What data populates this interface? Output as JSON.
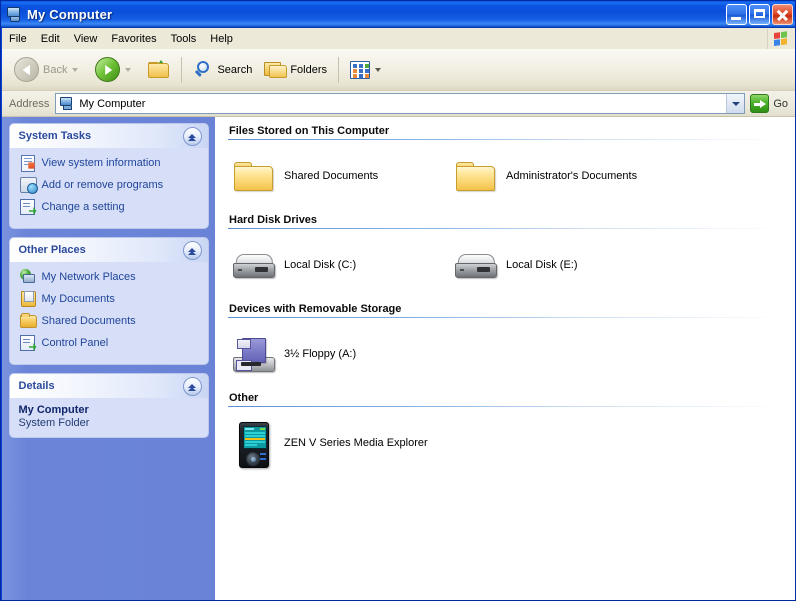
{
  "window": {
    "title": "My Computer",
    "title_icon": "my-computer-icon",
    "controls": {
      "minimize": "minimize-button",
      "maximize": "maximize-button",
      "close": "close-button"
    }
  },
  "menubar": {
    "items": [
      {
        "label": "File"
      },
      {
        "label": "Edit"
      },
      {
        "label": "View"
      },
      {
        "label": "Favorites"
      },
      {
        "label": "Tools"
      },
      {
        "label": "Help"
      }
    ],
    "brand_icon": "windows-flag-icon"
  },
  "toolbar": {
    "back_label": "Back",
    "back_icon": "back-arrow-icon",
    "forward_icon": "forward-arrow-icon",
    "up_icon": "up-folder-icon",
    "search_label": "Search",
    "search_icon": "search-magnifier-icon",
    "folders_label": "Folders",
    "folders_icon": "folders-icon",
    "views_icon": "views-grid-icon"
  },
  "address": {
    "label": "Address",
    "value": "My Computer",
    "icon": "my-computer-icon",
    "dropdown_icon": "chevron-down-icon",
    "go_label": "Go",
    "go_icon": "go-arrow-icon"
  },
  "sidebar": {
    "panels": [
      {
        "title": "System Tasks",
        "collapse_icon": "chevron-up-icon",
        "items": [
          {
            "label": "View system information",
            "icon": "system-info-icon"
          },
          {
            "label": "Add or remove programs",
            "icon": "add-remove-programs-icon"
          },
          {
            "label": "Change a setting",
            "icon": "change-setting-icon"
          }
        ]
      },
      {
        "title": "Other Places",
        "collapse_icon": "chevron-up-icon",
        "items": [
          {
            "label": "My Network Places",
            "icon": "network-places-icon"
          },
          {
            "label": "My Documents",
            "icon": "my-documents-icon"
          },
          {
            "label": "Shared Documents",
            "icon": "shared-documents-icon"
          },
          {
            "label": "Control Panel",
            "icon": "control-panel-icon"
          }
        ]
      },
      {
        "title": "Details",
        "collapse_icon": "chevron-up-icon",
        "name": "My Computer",
        "type": "System Folder"
      }
    ]
  },
  "content": {
    "groups": [
      {
        "title": "Files Stored on This Computer",
        "items": [
          {
            "label": "Shared Documents",
            "icon": "folder-icon"
          },
          {
            "label": "Administrator's Documents",
            "icon": "folder-icon"
          }
        ]
      },
      {
        "title": "Hard Disk Drives",
        "items": [
          {
            "label": "Local Disk (C:)",
            "icon": "hard-disk-icon"
          },
          {
            "label": "Local Disk (E:)",
            "icon": "hard-disk-icon"
          }
        ]
      },
      {
        "title": "Devices with Removable Storage",
        "items": [
          {
            "label": "3½ Floppy (A:)",
            "icon": "floppy-drive-icon"
          }
        ]
      },
      {
        "title": "Other",
        "items": [
          {
            "label": "ZEN V Series Media Explorer",
            "icon": "media-player-icon"
          }
        ]
      }
    ]
  },
  "colors": {
    "titlebar_blue": "#0a4ed9",
    "sidebar_blue": "#6a83d6",
    "panel_body": "#d6dff7",
    "link_blue": "#21459b",
    "accent_green": "#3f8e18",
    "close_red": "#c22d10"
  }
}
